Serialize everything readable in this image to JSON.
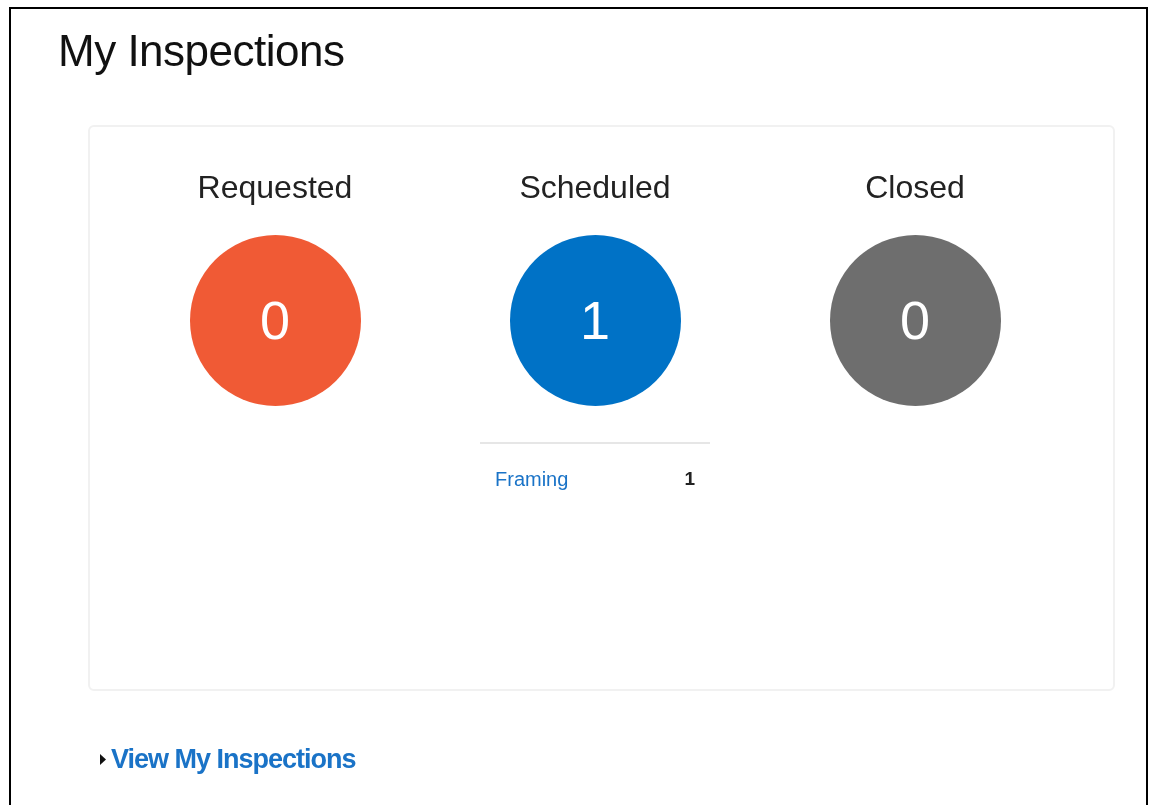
{
  "title": "My Inspections",
  "statuses": [
    {
      "label": "Requested",
      "count": "0",
      "color": "#f05a35"
    },
    {
      "label": "Scheduled",
      "count": "1",
      "color": "#0072c6",
      "breakdown": [
        {
          "type": "Framing",
          "count": "1"
        }
      ]
    },
    {
      "label": "Closed",
      "count": "0",
      "color": "#6e6e6e"
    }
  ],
  "link": {
    "label": "View My Inspections",
    "expanded": false
  }
}
